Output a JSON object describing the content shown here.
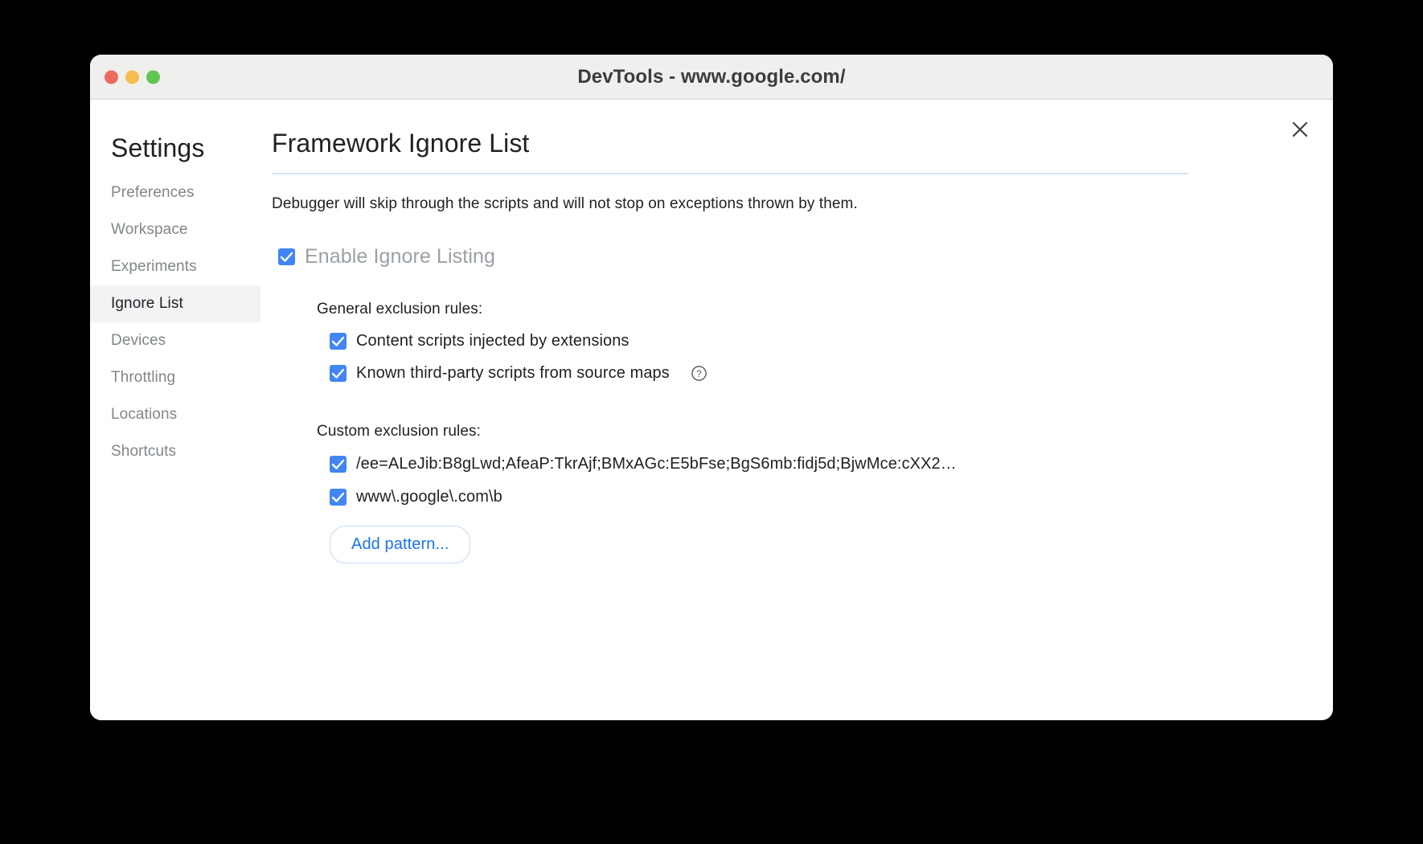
{
  "window": {
    "title": "DevTools - www.google.com/",
    "traffic_lights": [
      {
        "name": "close",
        "color": "#ec6a5f"
      },
      {
        "name": "minimize",
        "color": "#f4bd4f"
      },
      {
        "name": "maximize",
        "color": "#61c554"
      }
    ],
    "close_icon": "close-icon"
  },
  "sidebar": {
    "title": "Settings",
    "items": [
      {
        "label": "Preferences",
        "selected": false
      },
      {
        "label": "Workspace",
        "selected": false
      },
      {
        "label": "Experiments",
        "selected": false
      },
      {
        "label": "Ignore List",
        "selected": true
      },
      {
        "label": "Devices",
        "selected": false
      },
      {
        "label": "Throttling",
        "selected": false
      },
      {
        "label": "Locations",
        "selected": false
      },
      {
        "label": "Shortcuts",
        "selected": false
      }
    ]
  },
  "main": {
    "header": "Framework Ignore List",
    "description": "Debugger will skip through the scripts and will not stop on exceptions thrown by them.",
    "enable": {
      "label": "Enable Ignore Listing",
      "checked": true
    },
    "general_rules": {
      "title": "General exclusion rules:",
      "items": [
        {
          "label": "Content scripts injected by extensions",
          "checked": true,
          "help": false
        },
        {
          "label": "Known third-party scripts from source maps",
          "checked": true,
          "help": true
        }
      ]
    },
    "custom_rules": {
      "title": "Custom exclusion rules:",
      "items": [
        {
          "label": "/ee=ALeJib:B8gLwd;AfeaP:TkrAjf;BMxAGc:E5bFse;BgS6mb:fidj5d;BjwMce:cXX2…",
          "checked": true
        },
        {
          "label": "www\\.google\\.com\\b",
          "checked": true
        }
      ]
    },
    "add_button": "Add pattern...",
    "help_icon": "help-circle-icon"
  },
  "colors": {
    "accent": "#4285f4",
    "link": "#1a73e8",
    "text": "#202124",
    "muted": "#80868b",
    "divider": "#d8e2f7"
  }
}
